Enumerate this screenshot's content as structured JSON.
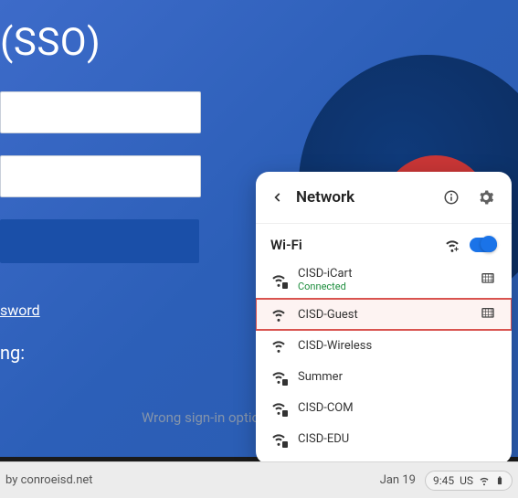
{
  "login": {
    "title_fragment": "(SSO)",
    "forgot_password_fragment": "sword",
    "ng_label_fragment": "ng:",
    "wrong_signin": "Wrong sign-in option?"
  },
  "network": {
    "title": "Network",
    "section_label": "Wi-Fi",
    "items": [
      {
        "name": "CISD-iCart",
        "status": "Connected",
        "secure": true,
        "proxy": true,
        "highlighted": false
      },
      {
        "name": "CISD-Guest",
        "status": "",
        "secure": false,
        "proxy": true,
        "highlighted": true
      },
      {
        "name": "CISD-Wireless",
        "status": "",
        "secure": false,
        "proxy": false,
        "highlighted": false
      },
      {
        "name": "Summer",
        "status": "",
        "secure": true,
        "proxy": false,
        "highlighted": false
      },
      {
        "name": "CISD-COM",
        "status": "",
        "secure": true,
        "proxy": false,
        "highlighted": false
      },
      {
        "name": "CISD-EDU",
        "status": "",
        "secure": true,
        "proxy": false,
        "highlighted": false
      }
    ]
  },
  "footer": {
    "managed_by": "by conroeisd.net",
    "date": "Jan 19",
    "time": "9:45",
    "locale": "US"
  }
}
